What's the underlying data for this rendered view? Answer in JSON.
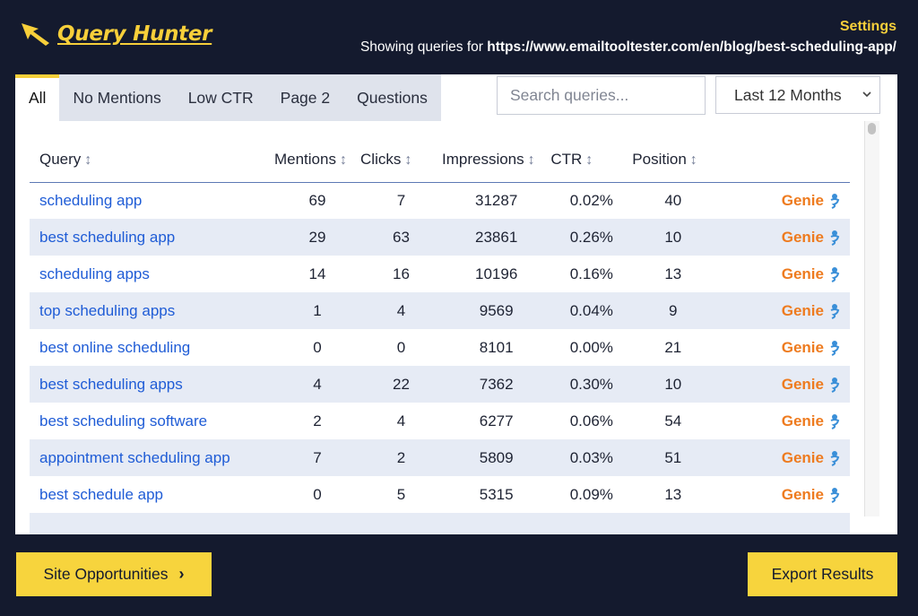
{
  "app": {
    "brand": "Query Hunter",
    "settings_label": "Settings",
    "showing_prefix": "Showing queries for",
    "site_url": "https://www.emailtooltester.com/en/blog/best-scheduling-app/"
  },
  "tabs": [
    {
      "label": "All",
      "active": true
    },
    {
      "label": "No Mentions",
      "active": false
    },
    {
      "label": "Low CTR",
      "active": false
    },
    {
      "label": "Page 2",
      "active": false
    },
    {
      "label": "Questions",
      "active": false
    }
  ],
  "search": {
    "placeholder": "Search queries...",
    "value": ""
  },
  "range_select": {
    "selected": "Last 12 Months"
  },
  "columns": {
    "query": "Query",
    "mentions": "Mentions",
    "clicks": "Clicks",
    "impressions": "Impressions",
    "ctr": "CTR",
    "position": "Position"
  },
  "rows": [
    {
      "query": "scheduling app",
      "mentions": "69",
      "clicks": "7",
      "impressions": "31287",
      "ctr": "0.02%",
      "position": "40",
      "action": "Genie"
    },
    {
      "query": "best scheduling app",
      "mentions": "29",
      "clicks": "63",
      "impressions": "23861",
      "ctr": "0.26%",
      "position": "10",
      "action": "Genie"
    },
    {
      "query": "scheduling apps",
      "mentions": "14",
      "clicks": "16",
      "impressions": "10196",
      "ctr": "0.16%",
      "position": "13",
      "action": "Genie"
    },
    {
      "query": "top scheduling apps",
      "mentions": "1",
      "clicks": "4",
      "impressions": "9569",
      "ctr": "0.04%",
      "position": "9",
      "action": "Genie"
    },
    {
      "query": "best online scheduling",
      "mentions": "0",
      "clicks": "0",
      "impressions": "8101",
      "ctr": "0.00%",
      "position": "21",
      "action": "Genie"
    },
    {
      "query": "best scheduling apps",
      "mentions": "4",
      "clicks": "22",
      "impressions": "7362",
      "ctr": "0.30%",
      "position": "10",
      "action": "Genie"
    },
    {
      "query": "best scheduling software",
      "mentions": "2",
      "clicks": "4",
      "impressions": "6277",
      "ctr": "0.06%",
      "position": "54",
      "action": "Genie"
    },
    {
      "query": "appointment scheduling app",
      "mentions": "7",
      "clicks": "2",
      "impressions": "5809",
      "ctr": "0.03%",
      "position": "51",
      "action": "Genie"
    },
    {
      "query": "best schedule app",
      "mentions": "0",
      "clicks": "5",
      "impressions": "5315",
      "ctr": "0.09%",
      "position": "13",
      "action": "Genie"
    },
    {
      "query": "",
      "mentions": "",
      "clicks": "",
      "impressions": "",
      "ctr": "",
      "position": "",
      "action": ""
    }
  ],
  "footer": {
    "site_opportunities": "Site Opportunities",
    "export": "Export Results"
  },
  "colors": {
    "background": "#141a2e",
    "accent": "#f7cf3a",
    "link": "#1f5cd6",
    "genie": "#ee7b1f",
    "row_stripe": "#e6ebf5"
  }
}
